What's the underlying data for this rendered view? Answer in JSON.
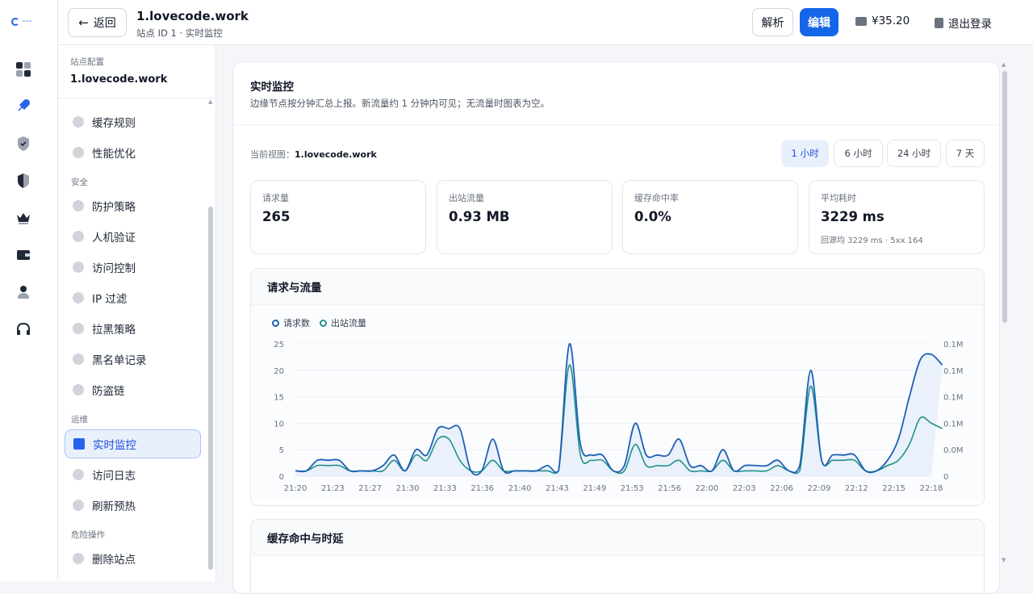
{
  "header": {
    "back_label": "返回",
    "title": "1.lovecode.work",
    "subtitle": "站点 ID 1 · 实时监控",
    "parse_label": "解析",
    "edit_label": "编辑",
    "balance": "¥35.20",
    "logout_label": "退出登录"
  },
  "rail": {
    "icons": [
      "dashboard-icon",
      "rocket-icon",
      "shield-check-icon",
      "shield-half-icon",
      "crown-icon",
      "wallet-icon",
      "user-icon",
      "headset-icon"
    ]
  },
  "sidebar": {
    "config_label": "站点配置",
    "site_name": "1.lovecode.work",
    "items_top": [
      {
        "label": "缓存规则",
        "icon": "layers-icon"
      },
      {
        "label": "性能优化",
        "icon": "gear-icon"
      }
    ],
    "section_security": "安全",
    "items_security": [
      {
        "label": "防护策略",
        "icon": "shield-icon"
      },
      {
        "label": "人机验证",
        "icon": "key-icon"
      },
      {
        "label": "访问控制",
        "icon": "shield-icon"
      },
      {
        "label": "IP 过滤",
        "icon": "filter-icon"
      },
      {
        "label": "拉黑策略",
        "icon": "shield-icon"
      },
      {
        "label": "黑名单记录",
        "icon": "shield-icon"
      },
      {
        "label": "防盗链",
        "icon": "link-icon"
      }
    ],
    "section_ops": "运维",
    "items_ops": [
      {
        "label": "实时监控",
        "icon": "bar-chart-icon",
        "active": true
      },
      {
        "label": "访问日志",
        "icon": "document-icon"
      },
      {
        "label": "刷新预热",
        "icon": "refresh-icon"
      }
    ],
    "section_danger": "危险操作",
    "items_danger": [
      {
        "label": "删除站点",
        "icon": "warning-icon"
      }
    ]
  },
  "main": {
    "title": "实时监控",
    "description": "边缘节点按分钟汇总上报。新流量约 1 分钟内可见；无流量时图表为空。",
    "view_label": "当前视图：",
    "view_value": "1.lovecode.work",
    "ranges": [
      "1 小时",
      "6 小时",
      "24 小时",
      "7 天"
    ],
    "active_range": "1 小时",
    "stats": [
      {
        "label": "请求量",
        "value": "265",
        "sub": ""
      },
      {
        "label": "出站流量",
        "value": "0.93 MB",
        "sub": ""
      },
      {
        "label": "缓存命中率",
        "value": "0.0%",
        "sub": ""
      },
      {
        "label": "平均耗时",
        "value": "3229 ms",
        "sub": "回源均 3229 ms · 5xx 164"
      }
    ],
    "panel1_title": "请求与流量",
    "panel2_title": "缓存命中与时延"
  },
  "colors": {
    "accent": "#1565e8",
    "series_requests": "#1f5fb4",
    "series_traffic": "#22928b"
  },
  "chart_data": {
    "type": "line",
    "title": "请求与流量",
    "x": [
      "21:20",
      "21:21",
      "21:22",
      "21:23",
      "21:24",
      "21:25",
      "21:26",
      "21:27",
      "21:28",
      "21:29",
      "21:30",
      "21:31",
      "21:32",
      "21:33",
      "21:34",
      "21:35",
      "21:36",
      "21:37",
      "21:38",
      "21:39",
      "21:40",
      "21:41",
      "21:42",
      "21:43",
      "21:44",
      "21:45",
      "21:46",
      "21:47",
      "21:48",
      "21:49",
      "21:50",
      "21:51",
      "21:52",
      "21:53",
      "21:54",
      "21:55",
      "21:56",
      "21:57",
      "21:58",
      "21:59",
      "22:00",
      "22:01",
      "22:02",
      "22:03",
      "22:04",
      "22:05",
      "22:06",
      "22:07",
      "22:08",
      "22:09",
      "22:10",
      "22:11",
      "22:12",
      "22:13",
      "22:14",
      "22:15",
      "22:16",
      "22:17",
      "22:18"
    ],
    "x_ticks": [
      "21:20",
      "21:23",
      "21:27",
      "21:30",
      "21:33",
      "21:36",
      "21:40",
      "21:43",
      "21:49",
      "21:53",
      "21:56",
      "22:00",
      "22:03",
      "22:06",
      "22:09",
      "22:12",
      "22:15",
      "22:18"
    ],
    "series": [
      {
        "name": "请求数",
        "axis": "left",
        "values": [
          1,
          1,
          3,
          3,
          3,
          1,
          1,
          1,
          2,
          4,
          1,
          5,
          4,
          9,
          9,
          9,
          1,
          1,
          7,
          1,
          1,
          1,
          1,
          2,
          1,
          25,
          6,
          4,
          4,
          1,
          2,
          10,
          4,
          4,
          4,
          7,
          2,
          2,
          1,
          5,
          1,
          2,
          2,
          2,
          3,
          1,
          2,
          20,
          3,
          4,
          4,
          4,
          1,
          1,
          3,
          7,
          15,
          22,
          23,
          21
        ]
      },
      {
        "name": "出站流量",
        "axis": "right",
        "values": [
          1,
          1,
          2,
          2,
          2,
          1,
          1,
          1,
          1,
          3,
          1,
          4,
          3,
          7,
          7,
          3,
          1,
          1,
          3,
          1,
          1,
          1,
          1,
          1,
          1,
          21,
          4,
          3,
          3,
          1,
          1,
          6,
          2,
          2,
          2,
          3,
          1,
          1,
          1,
          3,
          1,
          1,
          1,
          1,
          2,
          1,
          1,
          17,
          3,
          3,
          3,
          3,
          1,
          1,
          2,
          3,
          6,
          11,
          10,
          9
        ]
      }
    ],
    "ylim_left": [
      0,
      25
    ],
    "yticks_left": [
      "0",
      "5",
      "10",
      "15",
      "20",
      "25"
    ],
    "yticks_right": [
      "0",
      "0.0M",
      "0.1M",
      "0.1M",
      "0.1M",
      "0.1M"
    ],
    "legend_position": "top-left",
    "grid": true
  }
}
